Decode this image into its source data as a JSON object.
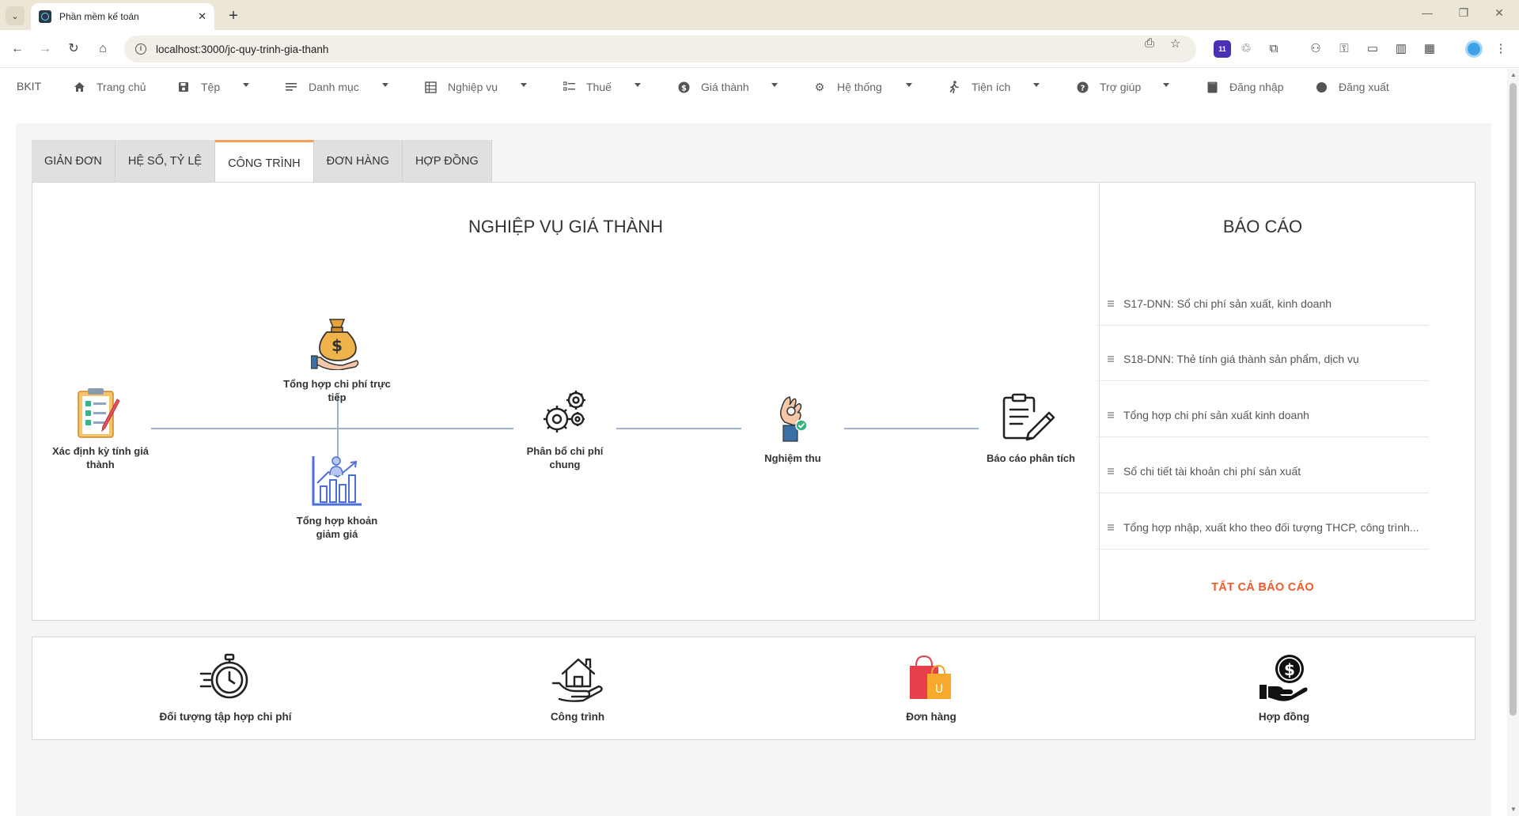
{
  "browser": {
    "tab_title": "Phần mềm kế toán",
    "url": "localhost:3000/jc-quy-trinh-gia-thanh",
    "extension_badge": "11"
  },
  "app": {
    "brand": "BKIT",
    "menu": [
      {
        "label": "Trang chủ",
        "icon": "home-icon",
        "has_dropdown": false
      },
      {
        "label": "Tệp",
        "icon": "save-icon",
        "has_dropdown": true
      },
      {
        "label": "Danh mục",
        "icon": "list-icon",
        "has_dropdown": true
      },
      {
        "label": "Nghiệp vụ",
        "icon": "grid-icon",
        "has_dropdown": true
      },
      {
        "label": "Thuế",
        "icon": "checklist-icon",
        "has_dropdown": true
      },
      {
        "label": "Giá thành",
        "icon": "dollar-circle-icon",
        "has_dropdown": true
      },
      {
        "label": "Hệ thống",
        "icon": "gear-icon",
        "has_dropdown": true
      },
      {
        "label": "Tiện ích",
        "icon": "walking-icon",
        "has_dropdown": true
      },
      {
        "label": "Trợ giúp",
        "icon": "help-icon",
        "has_dropdown": true
      },
      {
        "label": "Đăng nhập",
        "icon": "login-icon",
        "has_dropdown": false
      },
      {
        "label": "Đăng xuất",
        "icon": "logout-icon",
        "has_dropdown": false
      }
    ]
  },
  "content_tabs": [
    {
      "label": "GIẢN ĐƠN",
      "active": false
    },
    {
      "label": "HỆ SỐ, TỶ LỆ",
      "active": false
    },
    {
      "label": "CÔNG TRÌNH",
      "active": true
    },
    {
      "label": "ĐƠN HÀNG",
      "active": false
    },
    {
      "label": "HỢP ĐỒNG",
      "active": false
    }
  ],
  "process": {
    "title": "NGHIỆP VỤ GIÁ THÀNH",
    "nodes": {
      "register": {
        "label": "Xác định kỳ tính giá thành",
        "icon": "clipboard-checklist-icon"
      },
      "direct_cost": {
        "label": "Tổng hợp chi phí trực tiếp",
        "icon": "money-bag-hand-icon"
      },
      "discount": {
        "label": "Tổng hợp khoản giảm giá",
        "icon": "bar-chart-person-icon"
      },
      "allocate": {
        "label": "Phân bổ chi phí chung",
        "icon": "gears-icon"
      },
      "acceptance": {
        "label": "Nghiệm thu",
        "icon": "ok-hand-icon"
      },
      "report": {
        "label": "Báo cáo phân tích",
        "icon": "clipboard-pen-icon"
      }
    }
  },
  "reports": {
    "title": "BÁO CÁO",
    "items": [
      "S17-DNN: Sổ chi phí sản xuất, kinh doanh",
      "S18-DNN: Thẻ tính giá thành sản phẩm, dịch vụ",
      "Tổng hợp chi phí sản xuất kinh doanh",
      "Sổ chi tiết tài khoản chi phí sản xuất",
      "Tổng hợp nhập, xuất kho theo đối tượng THCP, công trình..."
    ],
    "all_label": "TẤT CẢ BÁO CÁO"
  },
  "shortcuts": [
    {
      "label": "Đối tượng tập hợp chi phí",
      "icon": "stopwatch-icon"
    },
    {
      "label": "Công trình",
      "icon": "house-hand-icon"
    },
    {
      "label": "Đơn hàng",
      "icon": "shopping-bags-icon"
    },
    {
      "label": "Hợp đồng",
      "icon": "dollar-hand-icon"
    }
  ],
  "colors": {
    "accent_tab": "#f7a05a",
    "link_orange": "#f05a28",
    "flow_line": "#9db4cc"
  }
}
